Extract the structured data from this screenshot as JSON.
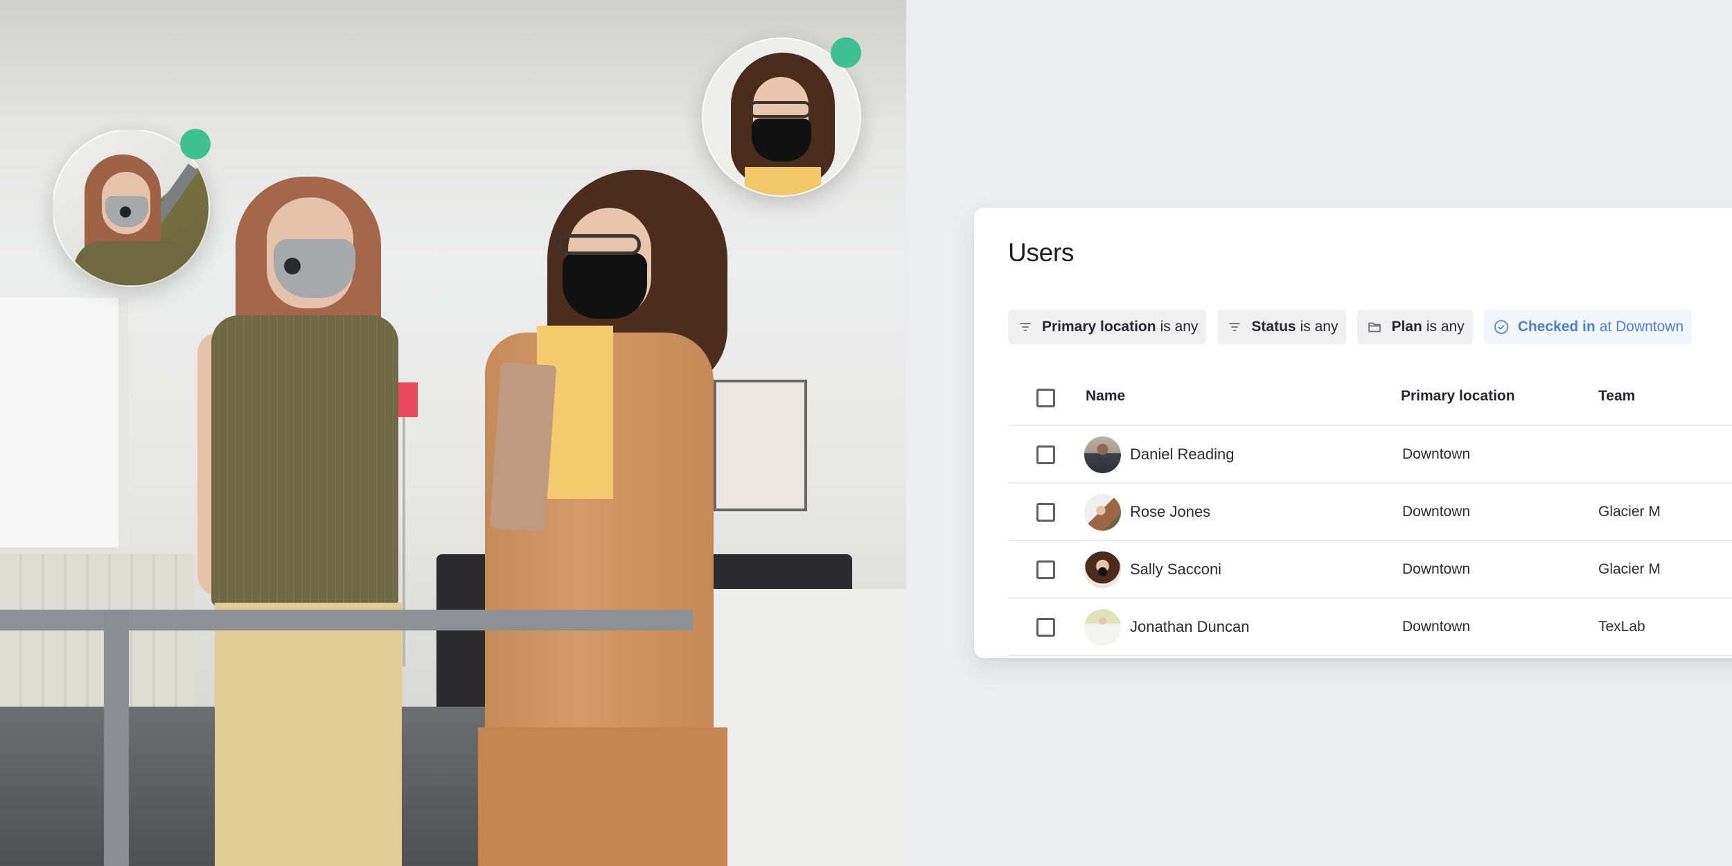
{
  "photo": {
    "description": "Two masked coworkers standing at a railing in an office",
    "floating_avatars": [
      {
        "person": "Rose Jones",
        "status": "online",
        "status_color": "#3fbf94"
      },
      {
        "person": "Sally Sacconi",
        "status": "online",
        "status_color": "#3fbf94"
      }
    ]
  },
  "users_panel": {
    "title": "Users",
    "filters": [
      {
        "icon": "filter-icon",
        "field": "Primary location",
        "condition": "is any",
        "active": false
      },
      {
        "icon": "filter-icon",
        "field": "Status",
        "condition": "is any",
        "active": false
      },
      {
        "icon": "folder-icon",
        "field": "Plan",
        "condition": "is any",
        "active": false
      },
      {
        "icon": "check-circle-icon",
        "field": "Checked in",
        "condition": "at Downtown",
        "active": true
      }
    ],
    "accent_color": "#4d7fcf",
    "table": {
      "columns": [
        "Name",
        "Primary location",
        "Team"
      ],
      "rows": [
        {
          "name": "Daniel Reading",
          "primary_location": "Downtown",
          "team": ""
        },
        {
          "name": "Rose Jones",
          "primary_location": "Downtown",
          "team": "Glacier M"
        },
        {
          "name": "Sally Sacconi",
          "primary_location": "Downtown",
          "team": "Glacier M"
        },
        {
          "name": "Jonathan Duncan",
          "primary_location": "Downtown",
          "team": "TexLab"
        }
      ]
    }
  }
}
